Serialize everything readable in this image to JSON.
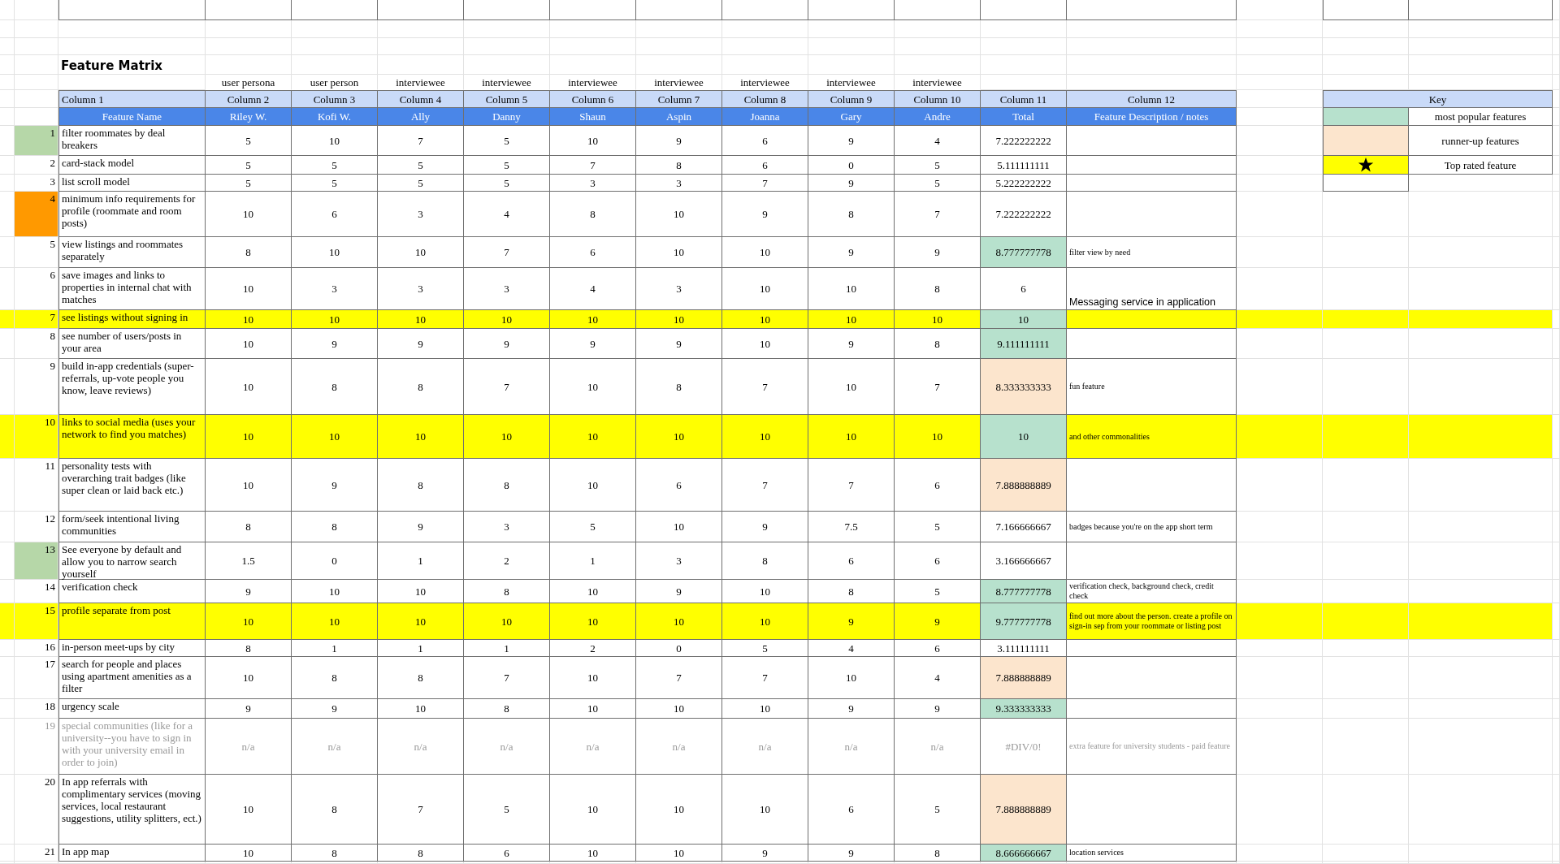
{
  "title": "Feature Matrix",
  "personas": [
    "user persona",
    "user person",
    "interviewee",
    "interviewee",
    "interviewee",
    "interviewee",
    "interviewee",
    "interviewee",
    "interviewee"
  ],
  "column_headers": [
    "Column 1",
    "Column 2",
    "Column 3",
    "Column 4",
    "Column 5",
    "Column 6",
    "Column 7",
    "Column 8",
    "Column 9",
    "Column 10",
    "Column 11",
    "Column 12"
  ],
  "field_headers": [
    "Feature Name",
    "Riley W.",
    "Kofi W.",
    "Ally",
    "Danny",
    "Shaun",
    "Aspin",
    "Joanna",
    "Gary",
    "Andre",
    "Total",
    "Feature Description / notes"
  ],
  "rows": [
    {
      "number": "1",
      "name": "filter roommates by deal breakers",
      "scores": [
        "5",
        "10",
        "7",
        "5",
        "10",
        "9",
        "6",
        "9",
        "4"
      ],
      "total": "7.222222222",
      "popular": false,
      "runner_up": false,
      "top_rated": false,
      "disabled": false,
      "color": "#b6d7a8"
    },
    {
      "number": "2",
      "name": "card-stack model",
      "scores": [
        "5",
        "5",
        "5",
        "5",
        "7",
        "8",
        "6",
        "0",
        "5"
      ],
      "total": "5.111111111",
      "popular": false,
      "runner_up": false,
      "top_rated": false,
      "disabled": false
    },
    {
      "number": "3",
      "name": "list scroll model",
      "scores": [
        "5",
        "5",
        "5",
        "5",
        "3",
        "3",
        "7",
        "9",
        "5"
      ],
      "total": "5.222222222",
      "popular": false,
      "runner_up": false,
      "top_rated": false,
      "disabled": false
    },
    {
      "number": "4",
      "name": "minimum info requirements for profile (roommate and room posts)",
      "scores": [
        "10",
        "6",
        "3",
        "4",
        "8",
        "10",
        "9",
        "8",
        "7"
      ],
      "total": "7.222222222",
      "popular": false,
      "runner_up": false,
      "top_rated": false,
      "disabled": false,
      "color": "#ff9900"
    },
    {
      "number": "5",
      "name": "view listings and roommates separately",
      "scores": [
        "8",
        "10",
        "10",
        "7",
        "6",
        "10",
        "10",
        "9",
        "9"
      ],
      "total": "8.777777778",
      "popular": true,
      "runner_up": false,
      "top_rated": false,
      "disabled": false,
      "note": {
        "kind": "small",
        "text": "filter view by need"
      }
    },
    {
      "number": "6",
      "name": "save images and links to properties in internal chat with matches",
      "scores": [
        "10",
        "3",
        "3",
        "3",
        "4",
        "3",
        "10",
        "10",
        "8"
      ],
      "total": "6",
      "popular": false,
      "runner_up": false,
      "top_rated": false,
      "disabled": false,
      "note": {
        "kind": "plain",
        "text": "Messaging service in application"
      }
    },
    {
      "number": "7",
      "name": "see listings without signing in",
      "scores": [
        "10",
        "10",
        "10",
        "10",
        "10",
        "10",
        "10",
        "10",
        "10"
      ],
      "total": "10",
      "popular": true,
      "runner_up": false,
      "top_rated": true,
      "disabled": false
    },
    {
      "number": "8",
      "name": "see number of users/posts in your area",
      "scores": [
        "10",
        "9",
        "9",
        "9",
        "9",
        "9",
        "10",
        "9",
        "8"
      ],
      "total": "9.111111111",
      "popular": true,
      "runner_up": false,
      "top_rated": false,
      "disabled": false
    },
    {
      "number": "9",
      "name": "build in-app credentials (super-referrals, up-vote people you know, leave reviews)",
      "scores": [
        "10",
        "8",
        "8",
        "7",
        "10",
        "8",
        "7",
        "10",
        "7"
      ],
      "total": "8.333333333",
      "popular": false,
      "runner_up": true,
      "top_rated": false,
      "disabled": false,
      "note": {
        "kind": "small",
        "text": "fun feature"
      }
    },
    {
      "number": "10",
      "name": "links to social media (uses your network to find you matches)",
      "scores": [
        "10",
        "10",
        "10",
        "10",
        "10",
        "10",
        "10",
        "10",
        "10"
      ],
      "total": "10",
      "popular": true,
      "runner_up": false,
      "top_rated": true,
      "disabled": false,
      "note": {
        "kind": "small",
        "text": "and other commonalities"
      }
    },
    {
      "number": "11",
      "name": "personality tests with overarching trait badges (like super clean or laid back etc.)",
      "scores": [
        "10",
        "9",
        "8",
        "8",
        "10",
        "6",
        "7",
        "7",
        "6"
      ],
      "total": "7.888888889",
      "popular": false,
      "runner_up": true,
      "top_rated": false,
      "disabled": false
    },
    {
      "number": "12",
      "name": "form/seek intentional living communities",
      "scores": [
        "8",
        "8",
        "9",
        "3",
        "5",
        "10",
        "9",
        "7.5",
        "5"
      ],
      "total": "7.166666667",
      "popular": false,
      "runner_up": false,
      "top_rated": false,
      "disabled": false,
      "note": {
        "kind": "small",
        "text": "badges because you're  on the app short term"
      }
    },
    {
      "number": "13",
      "name": "See everyone by default and allow you to narrow search yourself",
      "scores": [
        "1.5",
        "0",
        "1",
        "2",
        "1",
        "3",
        "8",
        "6",
        "6"
      ],
      "total": "3.166666667",
      "popular": false,
      "runner_up": false,
      "top_rated": false,
      "disabled": false,
      "color": "#b6d7a8"
    },
    {
      "number": "14",
      "name": "verification check",
      "scores": [
        "9",
        "10",
        "10",
        "8",
        "10",
        "9",
        "10",
        "8",
        "5"
      ],
      "total": "8.777777778",
      "popular": true,
      "runner_up": false,
      "top_rated": false,
      "disabled": false,
      "note": {
        "kind": "small",
        "text": "verification check, background check, credit check"
      }
    },
    {
      "number": "15",
      "name": "profile separate from post",
      "scores": [
        "10",
        "10",
        "10",
        "10",
        "10",
        "10",
        "10",
        "9",
        "9"
      ],
      "total": "9.777777778",
      "popular": true,
      "runner_up": false,
      "top_rated": true,
      "disabled": false,
      "note": {
        "kind": "small",
        "text": "find out more about the person. create a profile on sign-in sep from your roommate or listing post"
      }
    },
    {
      "number": "16",
      "name": "in-person meet-ups by city",
      "scores": [
        "8",
        "1",
        "1",
        "1",
        "2",
        "0",
        "5",
        "4",
        "6"
      ],
      "total": "3.111111111",
      "popular": false,
      "runner_up": false,
      "top_rated": false,
      "disabled": false
    },
    {
      "number": "17",
      "name": "search for people and places using apartment amenities as a filter",
      "scores": [
        "10",
        "8",
        "8",
        "7",
        "10",
        "7",
        "7",
        "10",
        "4"
      ],
      "total": "7.888888889",
      "popular": false,
      "runner_up": true,
      "top_rated": false,
      "disabled": false
    },
    {
      "number": "18",
      "name": "urgency scale",
      "scores": [
        "9",
        "9",
        "10",
        "8",
        "10",
        "10",
        "10",
        "9",
        "9"
      ],
      "total": "9.333333333",
      "popular": true,
      "runner_up": false,
      "top_rated": false,
      "disabled": false
    },
    {
      "number": "19",
      "name": "special communities (like for a university--you have to sign in with your university email in order to join)",
      "scores": [
        "n/a",
        "n/a",
        "n/a",
        "n/a",
        "n/a",
        "n/a",
        "n/a",
        "n/a",
        "n/a"
      ],
      "total": "#DIV/0!",
      "popular": false,
      "runner_up": false,
      "top_rated": false,
      "disabled": true,
      "note": {
        "kind": "small",
        "text": "extra feature for university students - paid feature"
      }
    },
    {
      "number": "20",
      "name": "In app referrals with complimentary services (moving services, local restaurant suggestions, utility splitters, ect.)",
      "scores": [
        "10",
        "8",
        "7",
        "5",
        "10",
        "10",
        "10",
        "6",
        "5"
      ],
      "total": "7.888888889",
      "popular": false,
      "runner_up": true,
      "top_rated": false,
      "disabled": false
    },
    {
      "number": "21",
      "name": "In app map",
      "scores": [
        "10",
        "8",
        "8",
        "6",
        "10",
        "10",
        "9",
        "9",
        "8"
      ],
      "total": "8.666666667",
      "popular": true,
      "runner_up": false,
      "top_rated": false,
      "disabled": false,
      "note": {
        "kind": "small",
        "text": "location services"
      }
    }
  ],
  "key": {
    "title": "Key",
    "items": [
      {
        "kind": "swatch",
        "color": "#b7e1cd",
        "label": "most popular features"
      },
      {
        "kind": "swatch",
        "color": "#fce5cd",
        "label": "runner-up features"
      },
      {
        "kind": "star",
        "color": "#ffff00",
        "label": "Top rated feature"
      }
    ]
  }
}
